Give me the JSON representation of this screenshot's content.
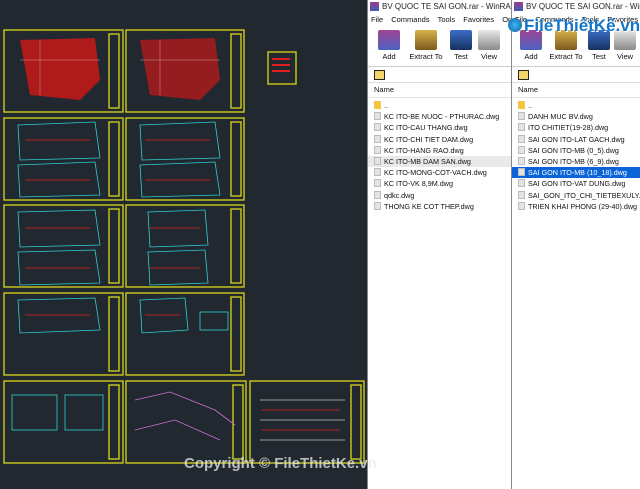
{
  "window_left": {
    "title": "BV QUOC TE SAI GON.rar - WinRAR",
    "menu": [
      "File",
      "Commands",
      "Tools",
      "Favorites",
      "Opt"
    ],
    "toolbar": [
      "Add",
      "Extract To",
      "Test",
      "View"
    ],
    "column_name": "Name",
    "files": [
      {
        "name": "..",
        "type": "folder"
      },
      {
        "name": "KC ITO-BE NUOC - PTHURAC.dwg",
        "type": "dwg"
      },
      {
        "name": "KC ITO-CAU THANG.dwg",
        "type": "dwg"
      },
      {
        "name": "KC ITO-CHI TIET DAM.dwg",
        "type": "dwg"
      },
      {
        "name": "KC ITO-HANG RAO.dwg",
        "type": "dwg"
      },
      {
        "name": "KC ITO-MB DAM SAN.dwg",
        "type": "dwg"
      },
      {
        "name": "KC ITO-MONG-COT-VACH.dwg",
        "type": "dwg"
      },
      {
        "name": "KC ITO-VK 8,9M.dwg",
        "type": "dwg"
      },
      {
        "name": "qdkc.dwg",
        "type": "dwg"
      },
      {
        "name": "THONG KE COT THEP.dwg",
        "type": "dwg"
      }
    ]
  },
  "window_right": {
    "title": "BV QUOC TE SAI GON.rar - WinRAR",
    "menu": [
      "File",
      "Commands",
      "Tools",
      "Favorites",
      "Op"
    ],
    "toolbar": [
      "Add",
      "Extract To",
      "Test",
      "View"
    ],
    "column_name": "Name",
    "selected_index": 6,
    "files": [
      {
        "name": "..",
        "type": "folder"
      },
      {
        "name": "DANH MUC BV.dwg",
        "type": "dwg"
      },
      {
        "name": "ITO CHITIET(19-28).dwg",
        "type": "dwg"
      },
      {
        "name": "SAI GON ITO-LAT GACH.dwg",
        "type": "dwg"
      },
      {
        "name": "SAI GON ITO-MB (0_5).dwg",
        "type": "dwg"
      },
      {
        "name": "SAI GON ITO-MB (6_9).dwg",
        "type": "dwg"
      },
      {
        "name": "SAI GON ITO-MB (10_18).dwg",
        "type": "dwg"
      },
      {
        "name": "SAI GON ITO-VAT DUNG.dwg",
        "type": "dwg"
      },
      {
        "name": "SAI_GON_ITO_CHI_TIETBEXULY.dwg",
        "type": "dwg"
      },
      {
        "name": "TRIEN KHAI PHONG  (29-40).dwg",
        "type": "dwg"
      }
    ]
  },
  "logo_text": "FileThiếtKế.vn",
  "watermark": "Copyright © FileThietKe.vn",
  "colors": {
    "cad_bg": "#212830",
    "cad_frame": "#d8d81a",
    "selection": "#0a64d8"
  },
  "icons": [
    "winrar-app-icon",
    "add-archive-icon",
    "extract-icon",
    "test-icon",
    "view-icon",
    "folder-up-icon",
    "folder-icon",
    "dwg-file-icon"
  ]
}
